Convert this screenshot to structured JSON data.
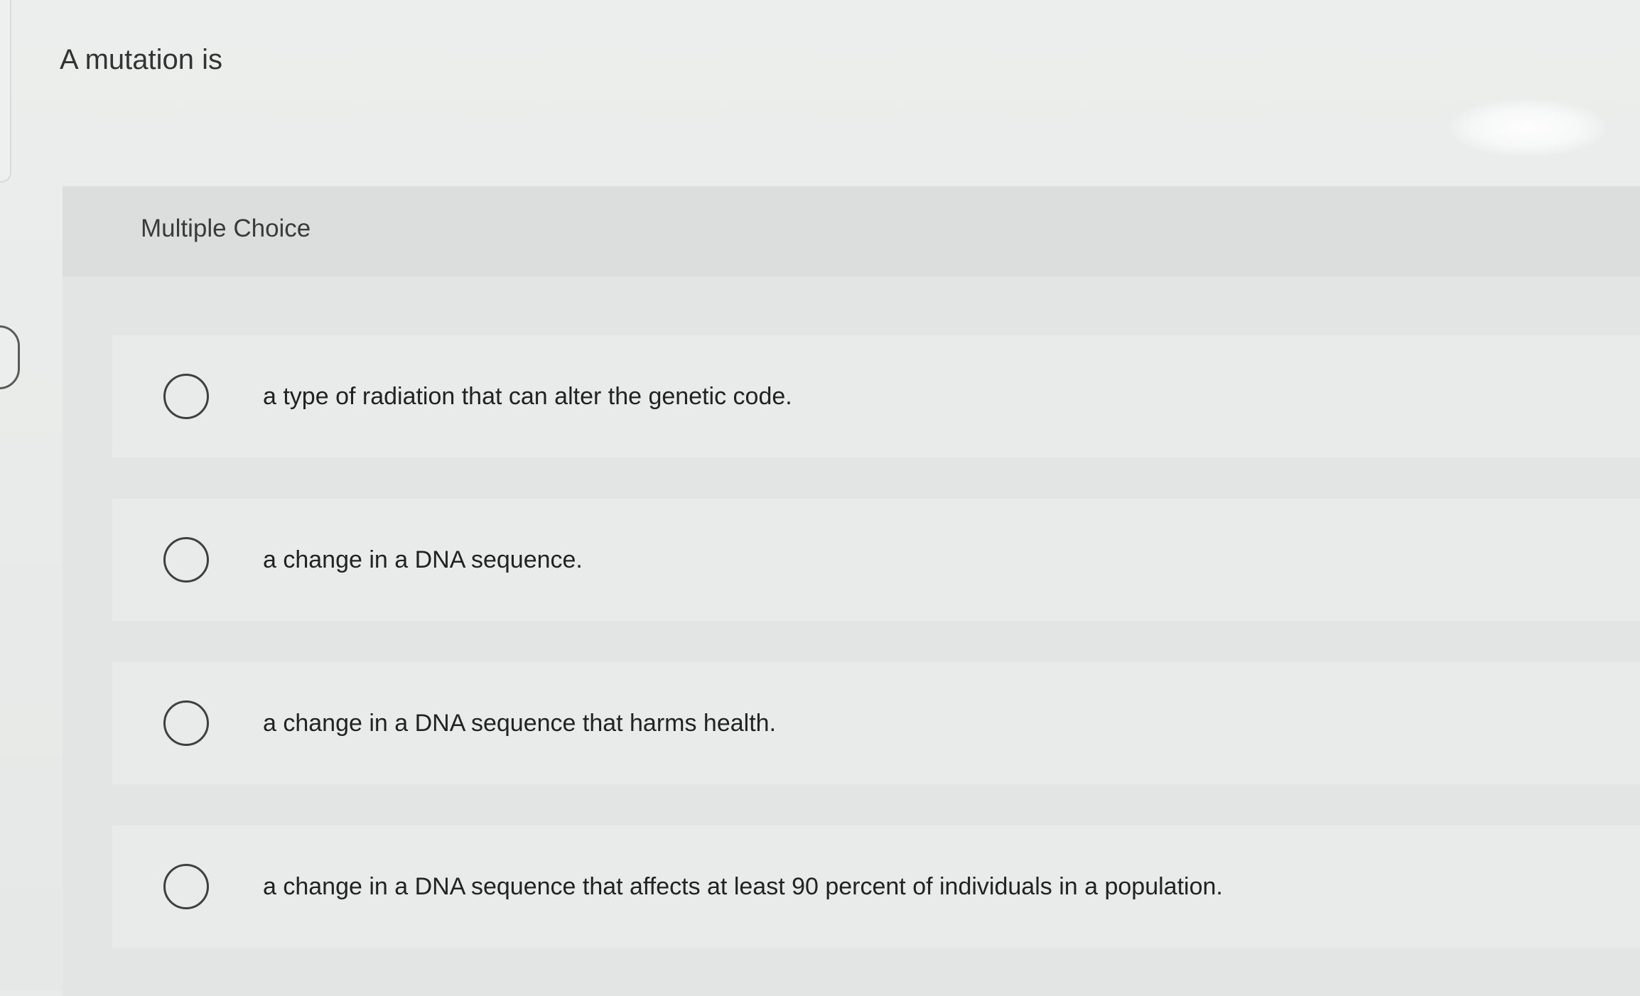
{
  "question": {
    "text": "A mutation is"
  },
  "panel": {
    "type_label": "Multiple Choice"
  },
  "options": [
    {
      "label": "a type of radiation that can alter the genetic code.",
      "selected": false
    },
    {
      "label": "a change in a DNA sequence.",
      "selected": false
    },
    {
      "label": "a change in a DNA sequence that harms health.",
      "selected": false
    },
    {
      "label": "a change in a DNA sequence that affects at least 90 percent of individuals in a population.",
      "selected": false
    }
  ],
  "colors": {
    "background": "#e9ebea",
    "panel": "#e3e5e4",
    "header": "#dcdedd",
    "radio_border": "#3f3f3f"
  },
  "icons": {
    "radio": "radio-button-unchecked-icon"
  }
}
